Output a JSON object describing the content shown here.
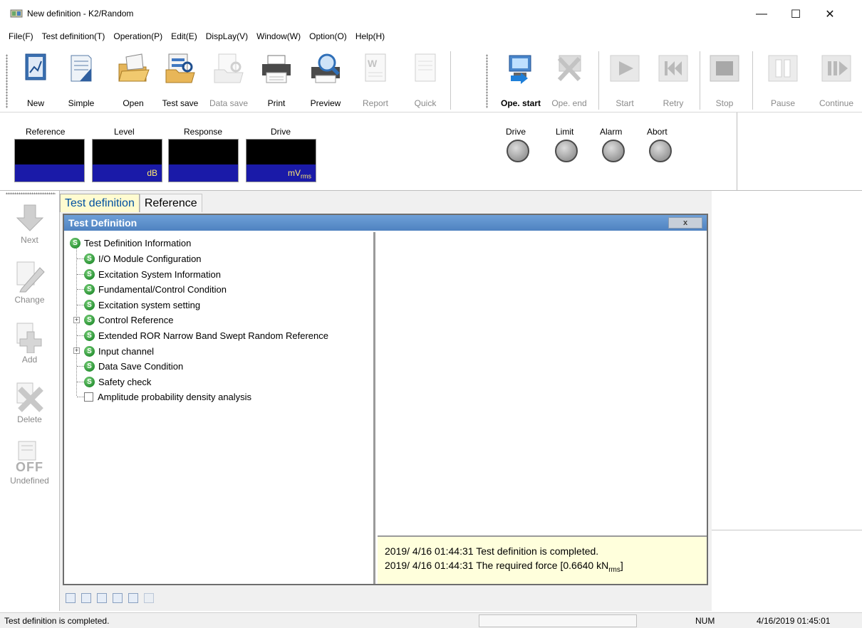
{
  "window": {
    "title": "New definition - K2/Random",
    "minimize": "—",
    "maximize": "☐",
    "close": "✕"
  },
  "menu": [
    "File(F)",
    "Test definition(T)",
    "Operation(P)",
    "Edit(E)",
    "DispLay(V)",
    "Window(W)",
    "Option(O)",
    "Help(H)"
  ],
  "toolbar": {
    "new": "New",
    "simple": "Simple",
    "open": "Open",
    "test_save": "Test save",
    "data_save": "Data save",
    "print": "Print",
    "preview": "Preview",
    "report": "Report",
    "quick": "Quick",
    "ope_start": "Ope. start",
    "ope_end": "Ope. end",
    "start": "Start",
    "retry": "Retry",
    "stop": "Stop",
    "pause": "Pause",
    "continue": "Continue"
  },
  "meters": {
    "reference": {
      "label": "Reference",
      "unit": ""
    },
    "level": {
      "label": "Level",
      "unit": "dB"
    },
    "response": {
      "label": "Response",
      "unit": ""
    },
    "drive": {
      "label": "Drive",
      "unit": "mV",
      "unit_sub": "rms"
    }
  },
  "lamps": {
    "drive": "Drive",
    "limit": "Limit",
    "alarm": "Alarm",
    "abort": "Abort"
  },
  "side": {
    "next": "Next",
    "change": "Change",
    "add": "Add",
    "delete": "Delete",
    "undefined": "Undefined",
    "off_badge": "OFF"
  },
  "tabs": {
    "test_definition": "Test definition",
    "reference": "Reference"
  },
  "panel": {
    "title": "Test Definition",
    "close": "x"
  },
  "tree": {
    "root": "Test Definition Information",
    "items": [
      "I/O Module Configuration",
      "Excitation System Information",
      "Fundamental/Control Condition",
      "Excitation system setting",
      "Control Reference",
      "Extended ROR Narrow Band Swept Random Reference",
      "Input channel",
      "Data Save Condition",
      "Safety check",
      "Amplitude probability density analysis"
    ]
  },
  "log": {
    "line1": "2019/ 4/16 01:44:31 Test definition is completed.",
    "line2": "2019/ 4/16 01:44:31 The required force [0.6640 kN",
    "line2_sub": "rms",
    "line2_end": "]"
  },
  "status": {
    "message": "Test definition is completed.",
    "num": "NUM",
    "datetime": "4/16/2019  01:45:01"
  },
  "colors": {
    "meter_bar": "#1a1aa8",
    "meter_text": "#ffe970",
    "panel_header": "#4f82c0",
    "log_bg": "#ffffdc",
    "status_green": "#1f8a2b"
  }
}
